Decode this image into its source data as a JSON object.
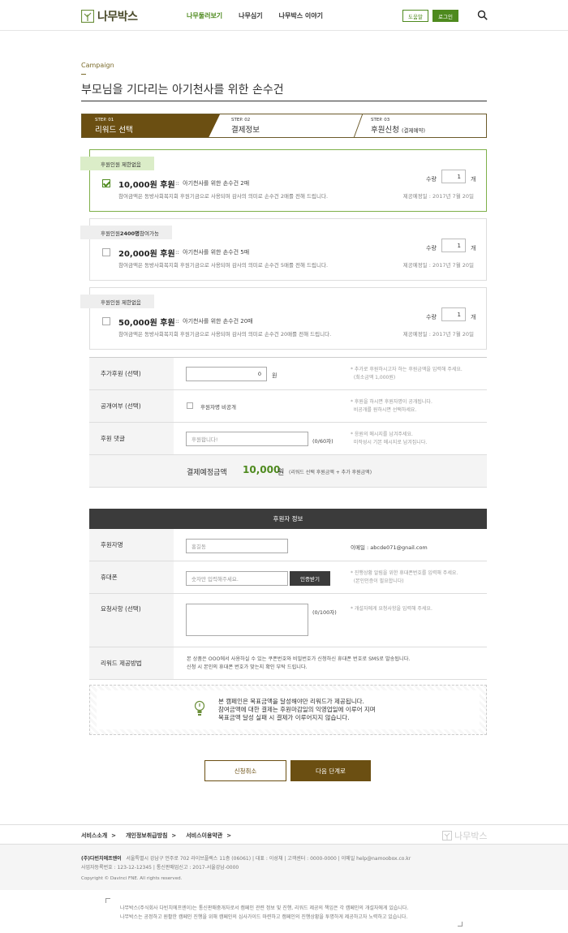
{
  "header": {
    "logo_text": "나무박스",
    "nav": [
      "나무둘러보기",
      "나무심기",
      "나무박스 이야기"
    ],
    "help_label": "도움말",
    "login_label": "로그인"
  },
  "page": {
    "breadcrumb": "Campaign",
    "title": "부모님을 기다리는 아기천사를 위한 손수건"
  },
  "steps": [
    {
      "num": "STEP. 01",
      "label": "리워드 선택"
    },
    {
      "num": "STEP. 02",
      "label": "결제정보"
    },
    {
      "num": "STEP. 03",
      "label": "후원신청",
      "sub": "(결제예약)"
    }
  ],
  "rewards": [
    {
      "tag_prefix": "후원인원 제한없음",
      "tag_bold": "",
      "tag_suffix": "",
      "amount": "10,000원 후원",
      "sep": "::",
      "desc": "아기천사를 위한 손수건 2매",
      "note": "참여금액은 동방사회복지회 후원기금으로 사용되며 감사의 의미로 손수건 2매를 전해 드립니다.",
      "qty_label": "수량",
      "qty": "1",
      "qty_unit": "개",
      "deliver": "제공예정일 : 2017년 7월 20일",
      "selected": true
    },
    {
      "tag_prefix": "후원인원 ",
      "tag_bold": "2400명",
      "tag_suffix": " 참여가능",
      "amount": "20,000원 후원",
      "sep": "::",
      "desc": "아기천사를 위한 손수건 5매",
      "note": "참여금액은 동방사회복지회 후원기금으로 사용되며 감사의 의미로 손수건 5매를 전해 드립니다.",
      "qty_label": "수량",
      "qty": "1",
      "qty_unit": "개",
      "deliver": "제공예정일 : 2017년 7월 20일",
      "selected": false
    },
    {
      "tag_prefix": "후원인원 제한없음",
      "tag_bold": "",
      "tag_suffix": "",
      "amount": "50,000원 후원",
      "sep": "::",
      "desc": "아기천사를 위한 손수건 20매",
      "note": "참여금액은 동방사회복지회 후원기금으로 사용되며 감사의 의미로 손수건 20매를 전해 드립니다.",
      "qty_label": "수량",
      "qty": "1",
      "qty_unit": "개",
      "deliver": "제공예정일 : 2017년 7월 20일",
      "selected": false
    }
  ],
  "form": {
    "extra_label": "추가후원 (선택)",
    "extra_value": "0",
    "extra_unit": "원",
    "extra_hint1": "* 추가로 후원하시고자 하는 후원금액을 입력해 주세요.",
    "extra_hint2": "(최소금액 1,000원)",
    "public_label": "공개여부 (선택)",
    "public_check": "후원자명 비공개",
    "public_hint1": "* 후원을 하시면 후원자명이 공개됩니다.",
    "public_hint2": "비공개를 원하시면 선택하세요.",
    "comment_label": "후원 댓글",
    "comment_placeholder": "후원합니다!",
    "comment_count": "(0/60자)",
    "comment_hint1": "* 응원의 메시지를 남겨주세요.",
    "comment_hint2": "미작성시 기본 메시지로 남겨집니다.",
    "total_label": "결제예정금액",
    "total_value": "10,000",
    "total_unit": "원",
    "total_note": "(리워드 선택 후원금액 + 추가 후원금액)"
  },
  "sponsor": {
    "heading": "후원자 정보",
    "name_label": "후원자명",
    "name_placeholder": "홍길동",
    "email_text": "이메일 : abcde071@gnail.com",
    "phone_label": "휴대폰",
    "phone_placeholder": "숫자만 입력해주세요.",
    "auth_button": "인증받기",
    "phone_hint1": "* 진행상황 알림을 위한 휴대폰번호를 입력해 주세요.",
    "phone_hint2": "(본인인증이 필요합니다)",
    "request_label": "요청사항 (선택)",
    "request_count": "(0/100자)",
    "request_hint": "* 개설자에게 요청사항을 입력해 주세요.",
    "method_label": "리워드 제공방법",
    "method_text1": "본 상품은 OOO에서 사용하실 수 있는 쿠폰번호와 비밀번호가 신청하신 휴대폰 번호로 SMS로 발송됩니다.",
    "method_text2": "신청 시 본인의 휴대폰 번호가 맞는지 확인 부탁 드립니다."
  },
  "notice": {
    "line1": "본 캠페인은 목표금액을 달성해야만 리워드가 제공됩니다.",
    "line2": "참여금액에 대한 결제는 후원마감일의 익영업일에 이루어 지며",
    "line3": "목표금액 달성 실패 시 결제가 이루어지지 않습니다."
  },
  "buttons": {
    "cancel": "신청취소",
    "next": "다음 단계로"
  },
  "footer": {
    "links": [
      "서비스소개",
      "개인정보취급방침",
      "서비스이용약관"
    ],
    "link_arrow": ">",
    "logo_text": "나무박스",
    "company": "(주)다빈치에프엔이",
    "address": "서울특별시 강남구 언주로 702 라이브플렉스 11층 (06061)",
    "ceo": "대표 : 이성채",
    "cs": "고객센터 : 0000-0000",
    "email": "이메일 help@namoobox.co.kr",
    "biz": "사업자등록번호 : 123-12-12345",
    "sales": "통신판매업신고 : 2017-서울강남-0000",
    "copyright": "Copyright © Davinci FNE. All rights reserved.",
    "disclaimer1": "나무박스(주식회사 다빈치에프엔이)는 통신판매중개자로서 캠페인 관련 정보 및 진행, 리워드 제공의 책임은 각 캠페인의 개설자에게 있습니다.",
    "disclaimer2": "나무박스는 공정하고 원활한 캠페인 진행을 위해 캠페인의 심사가이드 마련하고 캠페인의 진행상황을 투명하게 제공하고자 노력하고 있습니다."
  },
  "colors": {
    "brand_green": "#4e8a1e",
    "brand_brown": "#6b4f12",
    "dark_header": "#3b3b3b"
  }
}
